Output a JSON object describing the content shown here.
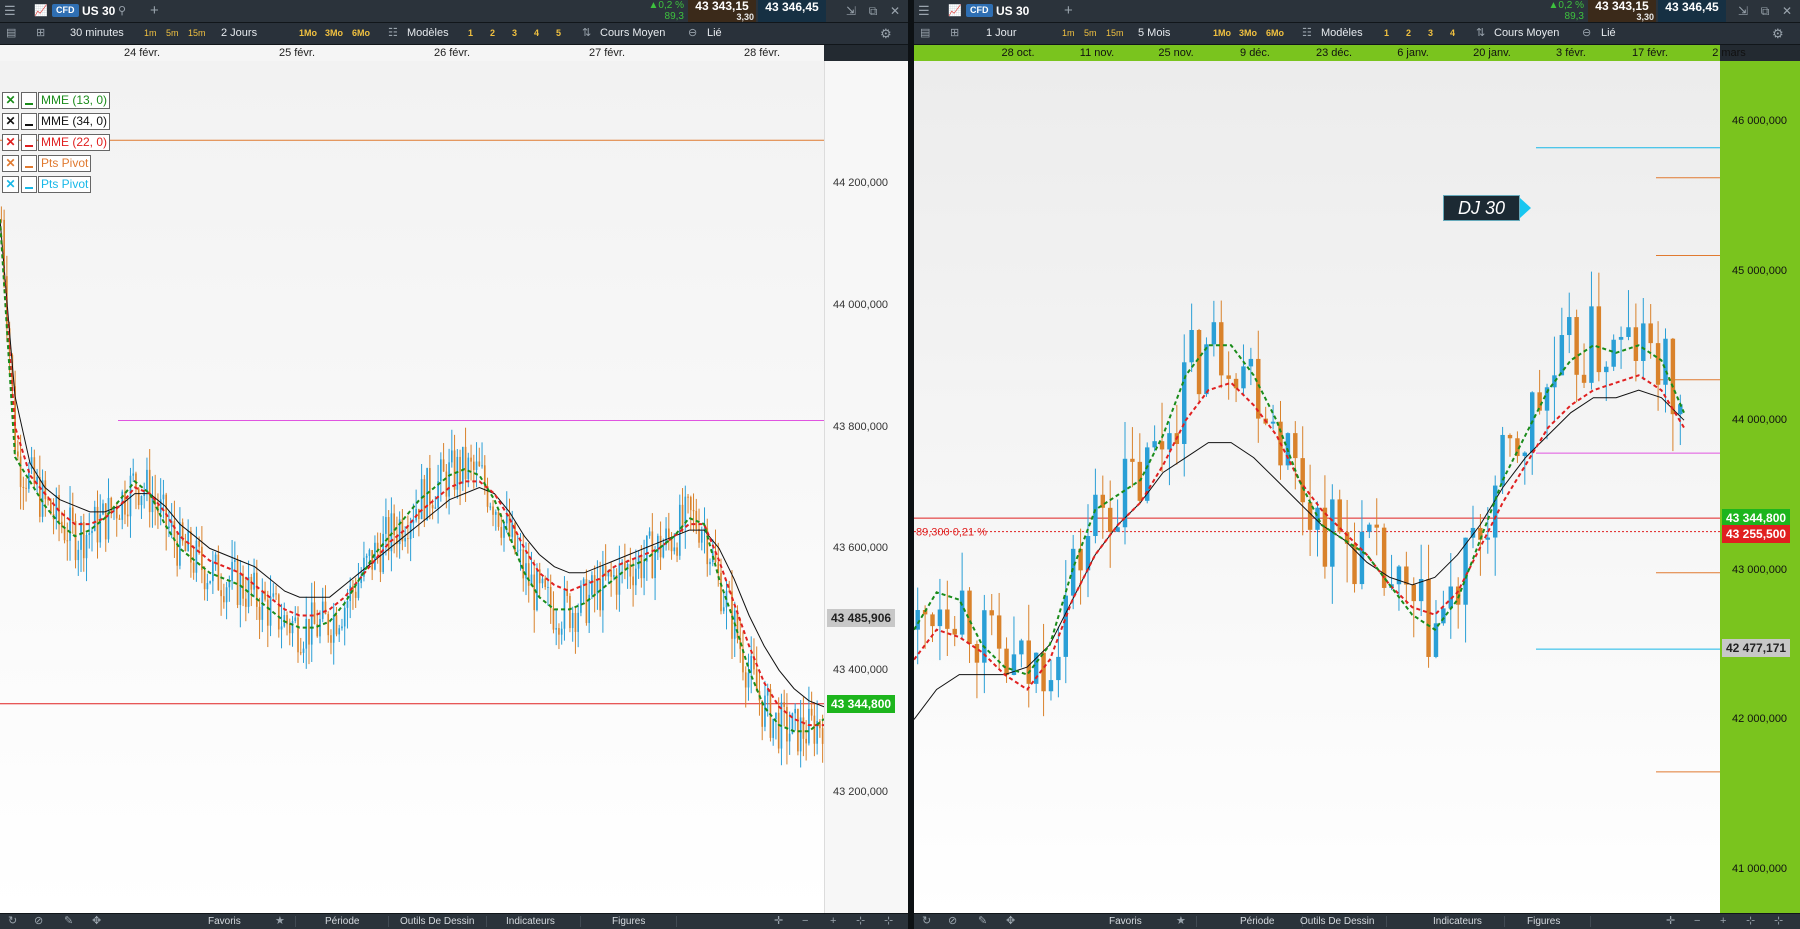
{
  "left": {
    "titlebar": {
      "badge": "CFD",
      "symbol": "US 30",
      "change_pct": "▲0,2 %",
      "change_pts": "89,3",
      "bid": "43 343,15",
      "spread": "3,30",
      "ask": "43 346,45"
    },
    "toolbar": {
      "interval": "30 minutes",
      "tf_1m": "1m",
      "tf_5m": "5m",
      "tf_15m": "15m",
      "period": "2 Jours",
      "p_1mo": "1Mo",
      "p_3mo": "3Mo",
      "p_6mo": "6Mo",
      "models": "Modèles",
      "n1": "1",
      "n2": "2",
      "n3": "3",
      "n4": "4",
      "n5": "5",
      "price_type": "Cours Moyen",
      "link": "Lié"
    },
    "dates": [
      "24 févr.",
      "25 févr.",
      "26 févr.",
      "27 févr.",
      "28 févr."
    ],
    "legend": [
      {
        "label": "MME (13, 0)",
        "color": "#1a8c1a"
      },
      {
        "label": "MME (34, 0)",
        "color": "#111111"
      },
      {
        "label": "MME (22, 0)",
        "color": "#e02020"
      },
      {
        "label": "Pts Pivot",
        "color": "#e07a30"
      },
      {
        "label": "Pts Pivot",
        "color": "#18b8e8"
      }
    ],
    "yticks": [
      "44 200,000",
      "44 000,000",
      "43 800,000",
      "43 600,000",
      "43 400,000",
      "43 200,000"
    ],
    "ymin": 43000,
    "ymax": 44400,
    "cursor_value": "43 485,906",
    "last_value": "43 344,800",
    "pivot_orange": 44270,
    "level_magenta": 43810,
    "level_red": 43345,
    "ema_values": {
      "ema13": [
        44140,
        43750,
        43710,
        43670,
        43640,
        43620,
        43630,
        43650,
        43680,
        43710,
        43690,
        43640,
        43600,
        43580,
        43560,
        43550,
        43540,
        43520,
        43500,
        43480,
        43470,
        43470,
        43480,
        43510,
        43550,
        43590,
        43620,
        43650,
        43680,
        43700,
        43720,
        43730,
        43720,
        43680,
        43620,
        43560,
        43520,
        43500,
        43500,
        43510,
        43530,
        43550,
        43570,
        43580,
        43600,
        43620,
        43650,
        43640,
        43550,
        43480,
        43400,
        43340,
        43310,
        43300,
        43300,
        43320
      ],
      "ema22": [
        44140,
        43800,
        43720,
        43690,
        43660,
        43640,
        43640,
        43650,
        43670,
        43700,
        43690,
        43660,
        43620,
        43600,
        43580,
        43570,
        43560,
        43540,
        43520,
        43500,
        43490,
        43490,
        43500,
        43520,
        43550,
        43580,
        43610,
        43630,
        43660,
        43680,
        43700,
        43710,
        43710,
        43690,
        43650,
        43600,
        43560,
        43540,
        43530,
        43540,
        43550,
        43570,
        43580,
        43590,
        43600,
        43620,
        43640,
        43640,
        43580,
        43510,
        43440,
        43380,
        43340,
        43320,
        43310,
        43310
      ],
      "ema34": [
        44140,
        43850,
        43740,
        43700,
        43680,
        43670,
        43660,
        43660,
        43670,
        43690,
        43690,
        43670,
        43640,
        43620,
        43600,
        43590,
        43580,
        43570,
        43550,
        43530,
        43520,
        43520,
        43520,
        43540,
        43560,
        43580,
        43600,
        43620,
        43640,
        43660,
        43680,
        43690,
        43700,
        43690,
        43660,
        43620,
        43590,
        43570,
        43560,
        43560,
        43570,
        43580,
        43590,
        43600,
        43610,
        43620,
        43630,
        43630,
        43600,
        43550,
        43490,
        43440,
        43400,
        43370,
        43350,
        43340
      ]
    },
    "bottom": {
      "favoris": "Favoris",
      "periode": "Période",
      "outils": "Outils De Dessin",
      "indicateurs": "Indicateurs",
      "figures": "Figures"
    }
  },
  "right": {
    "titlebar": {
      "badge": "CFD",
      "symbol": "US 30",
      "change_pct": "▲0,2 %",
      "change_pts": "89,3",
      "bid": "43 343,15",
      "spread": "3,30",
      "ask": "43 346,45"
    },
    "toolbar": {
      "interval": "1 Jour",
      "tf_1m": "1m",
      "tf_5m": "5m",
      "tf_15m": "15m",
      "period": "5 Mois",
      "p_1mo": "1Mo",
      "p_3mo": "3Mo",
      "p_6mo": "6Mo",
      "models": "Modèles",
      "n1": "1",
      "n2": "2",
      "n3": "3",
      "n4": "4",
      "price_type": "Cours Moyen",
      "link": "Lié"
    },
    "dates": [
      "28 oct.",
      "11 nov.",
      "25 nov.",
      "9 déc.",
      "23 déc.",
      "6 janv.",
      "20 janv.",
      "3 févr.",
      "17 févr.",
      "2 mars"
    ],
    "yticks": [
      "46 000,000",
      "45 000,000",
      "44 000,000",
      "43 000,000",
      "42 000,000",
      "41 000,000"
    ],
    "ymin": 40700,
    "ymax": 46400,
    "instrument_label": "DJ 30",
    "change_text": "89,300 0,21 %",
    "last_value": "43 344,800",
    "prev_close": "43 255,500",
    "cursor_value": "42 477,171",
    "level_red": 43345,
    "level_dotted": 43255,
    "level_magenta": 43780,
    "pivots_orange": [
      45620,
      45100,
      44270,
      42980,
      41650
    ],
    "pivots_cyan": [
      45820,
      42470
    ],
    "ema_values": {
      "ema13": [
        42600,
        42850,
        42800,
        42500,
        42350,
        42300,
        42500,
        43000,
        43400,
        43500,
        43600,
        43900,
        44300,
        44500,
        44500,
        44300,
        44000,
        43600,
        43300,
        43200,
        43100,
        42900,
        42700,
        42600,
        42800,
        43200,
        43600,
        43900,
        44200,
        44400,
        44500,
        44450,
        44500,
        44400,
        44050
      ],
      "ema22": [
        42400,
        42600,
        42550,
        42450,
        42300,
        42200,
        42400,
        42800,
        43100,
        43300,
        43450,
        43700,
        44000,
        44200,
        44250,
        44100,
        43900,
        43600,
        43400,
        43250,
        43100,
        42900,
        42750,
        42700,
        42850,
        43150,
        43450,
        43700,
        43950,
        44100,
        44200,
        44250,
        44300,
        44200,
        43950
      ],
      "ema34": [
        42000,
        42200,
        42300,
        42300,
        42300,
        42350,
        42500,
        42800,
        43100,
        43300,
        43450,
        43650,
        43750,
        43850,
        43850,
        43750,
        43600,
        43450,
        43300,
        43200,
        43050,
        42950,
        42900,
        42950,
        43100,
        43300,
        43550,
        43750,
        43900,
        44050,
        44150,
        44150,
        44200,
        44150,
        44000
      ]
    },
    "bottom": {
      "favoris": "Favoris",
      "periode": "Période",
      "outils": "Outils De Dessin",
      "indicateurs": "Indicateurs",
      "figures": "Figures"
    }
  },
  "colors": {
    "up": "#2a9fd6",
    "down": "#d9822b",
    "ema13": "#1a8c1a",
    "ema22": "#e02020",
    "ema34": "#111111",
    "pivot_orange": "#e07a30",
    "pivot_cyan": "#18b8e8",
    "level_magenta": "#e055e0",
    "last_value_bg": "#1db51d",
    "prev_close_bg": "#e02020",
    "cursor_bg": "#c8c8c8",
    "right_axis_bg": "#7ac41e"
  }
}
